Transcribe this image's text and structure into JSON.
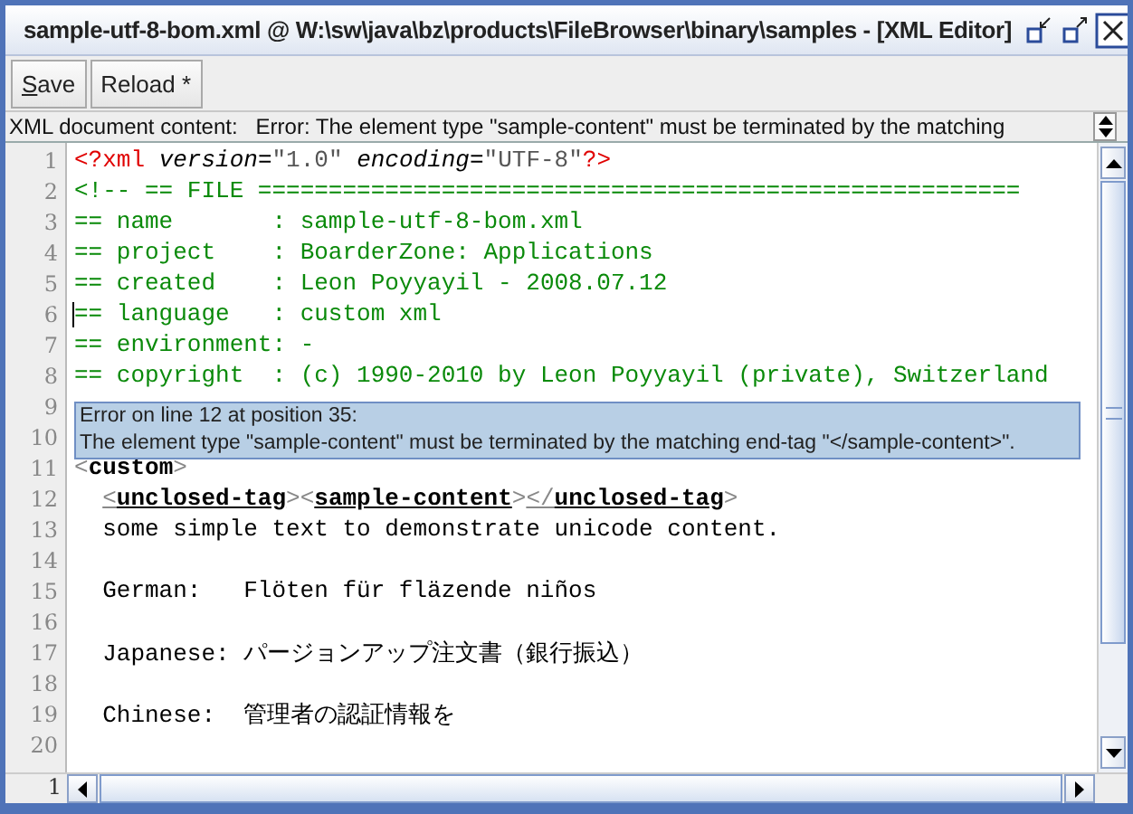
{
  "window": {
    "title": "sample-utf-8-bom.xml @ W:\\sw\\java\\bz\\products\\FileBrowser\\binary\\samples - [XML Editor]"
  },
  "toolbar": {
    "buttons": [
      {
        "mnemonic": "S",
        "rest": "ave"
      },
      {
        "rest": "Reload *"
      }
    ]
  },
  "status": {
    "label": "XML document content:",
    "message": "Error: The element type \"sample-content\" must be terminated by the matching"
  },
  "editor": {
    "lines": [
      {
        "number": "1",
        "caret": false,
        "tokens": [
          {
            "kind": "pi",
            "text": "<?xml"
          },
          {
            "kind": "attr",
            "text": " version"
          },
          {
            "kind": "plain",
            "text": "="
          },
          {
            "kind": "value",
            "text": "\"1.0\""
          },
          {
            "kind": "attr",
            "text": " encoding"
          },
          {
            "kind": "plain",
            "text": "="
          },
          {
            "kind": "value",
            "text": "\"UTF-8\""
          },
          {
            "kind": "pi",
            "text": "?>"
          }
        ]
      },
      {
        "number": "2",
        "caret": false,
        "tokens": [
          {
            "kind": "comment",
            "text": "<!-- == FILE ======================================================"
          }
        ]
      },
      {
        "number": "3",
        "caret": false,
        "tokens": [
          {
            "kind": "comment",
            "text": "== name       : sample-utf-8-bom.xml"
          }
        ]
      },
      {
        "number": "4",
        "caret": false,
        "tokens": [
          {
            "kind": "comment",
            "text": "== project    : BoarderZone: Applications"
          }
        ]
      },
      {
        "number": "5",
        "caret": false,
        "tokens": [
          {
            "kind": "comment",
            "text": "== created    : Leon Poyyayil - 2008.07.12"
          }
        ]
      },
      {
        "number": "6",
        "caret": true,
        "tokens": [
          {
            "kind": "comment",
            "text": "== language   : custom xml"
          }
        ]
      },
      {
        "number": "7",
        "caret": false,
        "tokens": [
          {
            "kind": "comment",
            "text": "== environment: -"
          }
        ]
      },
      {
        "number": "8",
        "caret": false,
        "tokens": [
          {
            "kind": "comment",
            "text": "== copyright  : (c) 1990-2010 by Leon Poyyayil (private), Switzerland"
          }
        ]
      },
      {
        "number": "9",
        "caret": false
      },
      {
        "number": "10",
        "caret": false
      },
      {
        "number": "11",
        "caret": false,
        "tokens": [
          {
            "kind": "punct",
            "text": "<"
          },
          {
            "kind": "tag",
            "text": "custom"
          },
          {
            "kind": "punct",
            "text": ">"
          }
        ]
      },
      {
        "number": "12",
        "caret": false,
        "indented": true,
        "tokens": [
          {
            "kind": "punct",
            "text": "<",
            "error": true
          },
          {
            "kind": "tag",
            "text": "unclosed-tag",
            "error": true
          },
          {
            "kind": "punct",
            "text": ">"
          },
          {
            "kind": "punct",
            "text": "<"
          },
          {
            "kind": "tag",
            "text": "sample-content",
            "error": true
          },
          {
            "kind": "punct",
            "text": ">"
          },
          {
            "kind": "punct",
            "text": "</",
            "error": true
          },
          {
            "kind": "tag",
            "text": "unclosed-tag",
            "error": true
          },
          {
            "kind": "punct",
            "text": ">"
          }
        ]
      },
      {
        "number": "13",
        "caret": false,
        "indented": true,
        "tokens": [
          {
            "kind": "plain",
            "text": "some simple text to demonstrate unicode content."
          }
        ]
      },
      {
        "number": "14",
        "caret": false
      },
      {
        "number": "15",
        "caret": false,
        "indented": true,
        "tokens": [
          {
            "kind": "plain",
            "text": "German:   Flöten für fläzende niños"
          }
        ]
      },
      {
        "number": "16",
        "caret": false
      },
      {
        "number": "17",
        "caret": false,
        "indented": true,
        "tokens": [
          {
            "kind": "plain",
            "text": "Japanese: パージョンアップ注文書（銀行振込）"
          }
        ]
      },
      {
        "number": "18",
        "caret": false
      },
      {
        "number": "19",
        "caret": false,
        "indented": true,
        "tokens": [
          {
            "kind": "plain",
            "text": "Chinese:  管理者の認証情報を"
          }
        ]
      },
      {
        "number": "20",
        "caret": false
      }
    ],
    "corner_label": "1"
  },
  "tooltip": {
    "lines": [
      "Error on line 12 at position 35:",
      "The element type \"sample-content\" must be terminated by the matching end-tag \"</sample-content>\"."
    ]
  }
}
